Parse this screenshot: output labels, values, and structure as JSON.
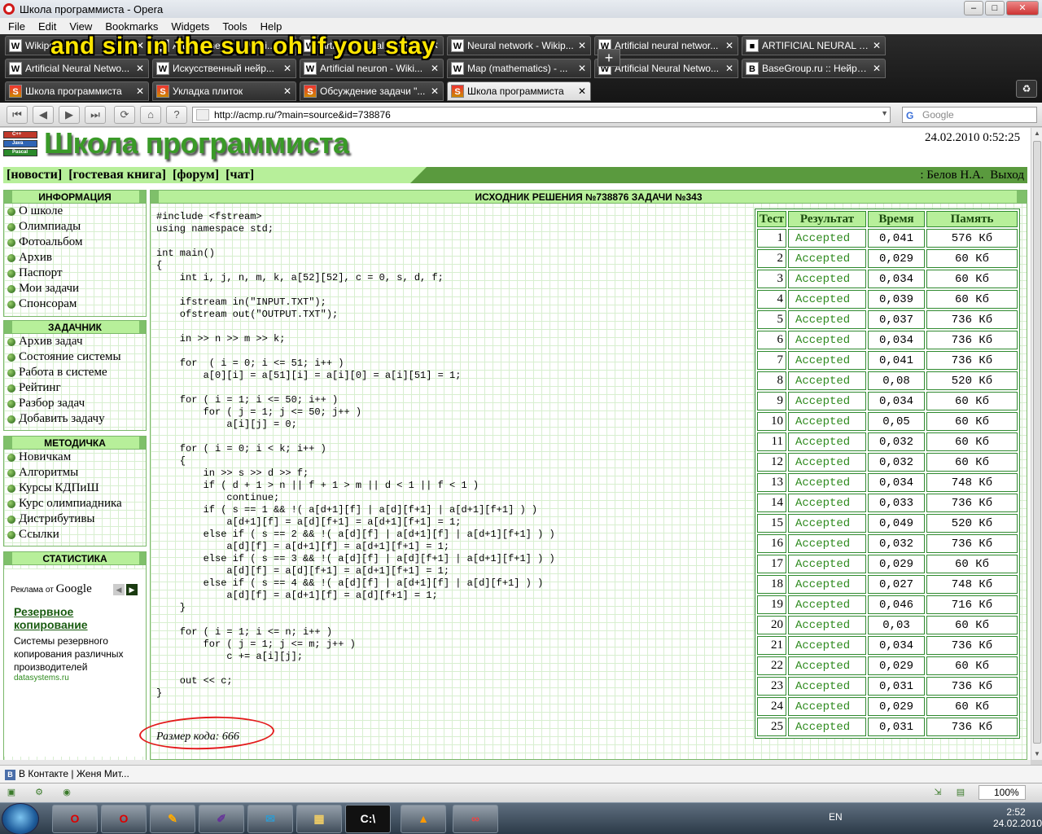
{
  "window": {
    "title": "Школа программиста - Opera"
  },
  "menu": [
    "File",
    "Edit",
    "View",
    "Bookmarks",
    "Widgets",
    "Tools",
    "Help"
  ],
  "overlay_text": "and sin in the sun oh if you stay",
  "tabs_row1": [
    {
      "label": "Wikipedia",
      "fav": "W"
    },
    {
      "label": "Artificial neuron - Wiki...",
      "fav": "W"
    },
    {
      "label": "Artificial neural network",
      "fav": "W"
    },
    {
      "label": "Neural network - Wikip...",
      "fav": "W"
    },
    {
      "label": "Artificial neural networ...",
      "fav": "W"
    },
    {
      "label": "ARTIFICIAL NEURAL N...",
      "fav": "■"
    }
  ],
  "tabs_row2": [
    {
      "label": "Artificial Neural Netwo...",
      "fav": "W"
    },
    {
      "label": "Искусственный нейр...",
      "fav": "W"
    },
    {
      "label": "Artificial neuron - Wiki...",
      "fav": "W"
    },
    {
      "label": "Map (mathematics) - ...",
      "fav": "W"
    },
    {
      "label": "Artificial Neural Netwo...",
      "fav": "W"
    },
    {
      "label": "BaseGroup.ru :: Нейро...",
      "fav": "B"
    }
  ],
  "tabs_row3": [
    {
      "label": "Школа программиста",
      "fav": "S"
    },
    {
      "label": "Укладка плиток",
      "fav": "S"
    },
    {
      "label": "Обсуждение задачи \"...",
      "fav": "S"
    },
    {
      "label": "Школа программиста",
      "fav": "S",
      "active": true
    }
  ],
  "address": {
    "url": "http://acmp.ru/?main=source&id=738876",
    "search_placeholder": "Google"
  },
  "site": {
    "title": "Школа программиста",
    "logo_lines": [
      "C++",
      "Java",
      "Pascal"
    ],
    "datetime": "24.02.2010 0:52:25",
    "nav": [
      "[новости]",
      "[гостевая книга]",
      "[форум]",
      "[чат]"
    ],
    "user": ": Белов Н.А.",
    "logout": "Выход"
  },
  "sidebar": {
    "sections": [
      {
        "title": "ИНФОРМАЦИЯ",
        "items": [
          "О школе",
          "Олимпиады",
          "Фотоальбом",
          "Архив",
          "Паспорт",
          "Мои задачи",
          "Спонсорам"
        ]
      },
      {
        "title": "ЗАДАЧНИК",
        "items": [
          "Архив задач",
          "Состояние системы",
          "Работа в системе",
          "Рейтинг",
          "Разбор задач",
          "Добавить задачу"
        ]
      },
      {
        "title": "МЕТОДИЧКА",
        "items": [
          "Новичкам",
          "Алгоритмы",
          "Курсы КДПиШ",
          "Курс олимпиадника",
          "Дистрибутивы",
          "Ссылки"
        ]
      },
      {
        "title": "СТАТИСТИКА",
        "items": []
      }
    ],
    "ad": {
      "header_prefix": "Реклама от",
      "header_brand": "Google",
      "title": "Резервное копирование",
      "text": "Системы резервного копирования различных производителей",
      "url": "datasystems.ru"
    }
  },
  "content": {
    "heading": "ИСХОДНИК РЕШЕНИЯ №738876 ЗАДАЧИ №343",
    "code": "#include <fstream>\nusing namespace std;\n\nint main()\n{\n    int i, j, n, m, k, a[52][52], c = 0, s, d, f;\n\n    ifstream in(\"INPUT.TXT\");\n    ofstream out(\"OUTPUT.TXT\");\n\n    in >> n >> m >> k;\n\n    for  ( i = 0; i <= 51; i++ )\n        a[0][i] = a[51][i] = a[i][0] = a[i][51] = 1;\n\n    for ( i = 1; i <= 50; i++ )\n        for ( j = 1; j <= 50; j++ )\n            a[i][j] = 0;\n\n    for ( i = 0; i < k; i++ )\n    {\n        in >> s >> d >> f;\n        if ( d + 1 > n || f + 1 > m || d < 1 || f < 1 )\n            continue;\n        if ( s == 1 && !( a[d+1][f] | a[d][f+1] | a[d+1][f+1] ) )\n            a[d+1][f] = a[d][f+1] = a[d+1][f+1] = 1;\n        else if ( s == 2 && !( a[d][f] | a[d+1][f] | a[d+1][f+1] ) )\n            a[d][f] = a[d+1][f] = a[d+1][f+1] = 1;\n        else if ( s == 3 && !( a[d][f] | a[d][f+1] | a[d+1][f+1] ) )\n            a[d][f] = a[d][f+1] = a[d+1][f+1] = 1;\n        else if ( s == 4 && !( a[d][f] | a[d+1][f] | a[d][f+1] ) )\n            a[d][f] = a[d+1][f] = a[d][f+1] = 1;\n    }\n\n    for ( i = 1; i <= n; i++ )\n        for ( j = 1; j <= m; j++ )\n            c += a[i][j];\n\n    out << c;\n}",
    "code_size": "Размер кода: 666",
    "results_headers": [
      "Тест",
      "Результат",
      "Время",
      "Память"
    ],
    "results": [
      [
        "1",
        "Accepted",
        "0,041",
        "576 Кб"
      ],
      [
        "2",
        "Accepted",
        "0,029",
        "60 Кб"
      ],
      [
        "3",
        "Accepted",
        "0,034",
        "60 Кб"
      ],
      [
        "4",
        "Accepted",
        "0,039",
        "60 Кб"
      ],
      [
        "5",
        "Accepted",
        "0,037",
        "736 Кб"
      ],
      [
        "6",
        "Accepted",
        "0,034",
        "736 Кб"
      ],
      [
        "7",
        "Accepted",
        "0,041",
        "736 Кб"
      ],
      [
        "8",
        "Accepted",
        "0,08",
        "520 Кб"
      ],
      [
        "9",
        "Accepted",
        "0,034",
        "60 Кб"
      ],
      [
        "10",
        "Accepted",
        "0,05",
        "60 Кб"
      ],
      [
        "11",
        "Accepted",
        "0,032",
        "60 Кб"
      ],
      [
        "12",
        "Accepted",
        "0,032",
        "60 Кб"
      ],
      [
        "13",
        "Accepted",
        "0,034",
        "748 Кб"
      ],
      [
        "14",
        "Accepted",
        "0,033",
        "736 Кб"
      ],
      [
        "15",
        "Accepted",
        "0,049",
        "520 Кб"
      ],
      [
        "16",
        "Accepted",
        "0,032",
        "736 Кб"
      ],
      [
        "17",
        "Accepted",
        "0,029",
        "60 Кб"
      ],
      [
        "18",
        "Accepted",
        "0,027",
        "748 Кб"
      ],
      [
        "19",
        "Accepted",
        "0,046",
        "716 Кб"
      ],
      [
        "20",
        "Accepted",
        "0,03",
        "60 Кб"
      ],
      [
        "21",
        "Accepted",
        "0,034",
        "736 Кб"
      ],
      [
        "22",
        "Accepted",
        "0,029",
        "60 Кб"
      ],
      [
        "23",
        "Accepted",
        "0,031",
        "736 Кб"
      ],
      [
        "24",
        "Accepted",
        "0,029",
        "60 Кб"
      ],
      [
        "25",
        "Accepted",
        "0,031",
        "736 Кб"
      ]
    ]
  },
  "panel": {
    "bookmark": "В Контакте | Женя Мит..."
  },
  "status": {
    "zoom": "100%"
  },
  "taskbar": {
    "lang": "EN",
    "time": "2:52",
    "date": "24.02.2010"
  },
  "colors": {
    "accent_green": "#3a9a28",
    "light_green": "#b7ef9a",
    "accepted": "#2e8a1e"
  }
}
